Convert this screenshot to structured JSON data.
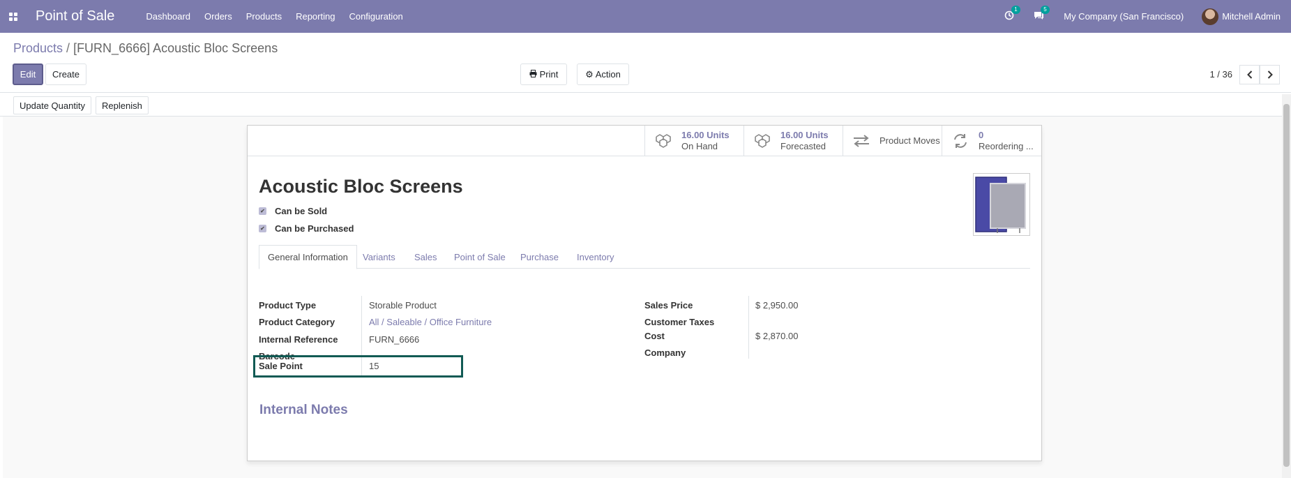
{
  "navbar": {
    "app_name": "Point of Sale",
    "menu": [
      "Dashboard",
      "Orders",
      "Products",
      "Reporting",
      "Configuration"
    ],
    "activity_badge": "1",
    "messages_badge": "5",
    "company": "My Company (San Francisco)",
    "user": "Mitchell Admin",
    "color": "#7c7bad"
  },
  "breadcrumb": {
    "parent": "Products",
    "separator": "/",
    "current": "[FURN_6666] Acoustic Bloc Screens"
  },
  "toolbar": {
    "edit": "Edit",
    "create": "Create",
    "print": "Print",
    "action": "Action",
    "pager": "1 / 36"
  },
  "actions": {
    "update_quantity": "Update Quantity",
    "replenish": "Replenish"
  },
  "stat_buttons": [
    {
      "value": "16.00 Units",
      "label": "On Hand",
      "icon": "cubes-icon"
    },
    {
      "value": "16.00 Units",
      "label": "Forecasted",
      "icon": "cubes-icon"
    },
    {
      "value": "",
      "label": "Product Moves",
      "icon": "exchange-icon"
    },
    {
      "value": "0",
      "label": "Reordering ...",
      "icon": "refresh-icon"
    }
  ],
  "product": {
    "name": "Acoustic Bloc Screens",
    "can_be_sold": "Can be Sold",
    "can_be_purchased": "Can be Purchased"
  },
  "tabs": [
    "General Information",
    "Variants",
    "Sales",
    "Point of Sale",
    "Purchase",
    "Inventory"
  ],
  "left_fields": [
    {
      "label": "Product Type",
      "value": "Storable Product"
    },
    {
      "label": "Product Category",
      "value": "All / Saleable / Office Furniture"
    },
    {
      "label": "Internal Reference",
      "value": "FURN_6666"
    },
    {
      "label": "Barcode",
      "value": ""
    },
    {
      "label": "Sale Point",
      "value": "15"
    }
  ],
  "right_fields": [
    {
      "label": "Sales Price",
      "value": "$ 2,950.00"
    },
    {
      "label": "Customer Taxes",
      "value": ""
    },
    {
      "label": "Cost",
      "value": "$ 2,870.00"
    },
    {
      "label": "Company",
      "value": ""
    }
  ],
  "notes": {
    "title": "Internal Notes"
  }
}
